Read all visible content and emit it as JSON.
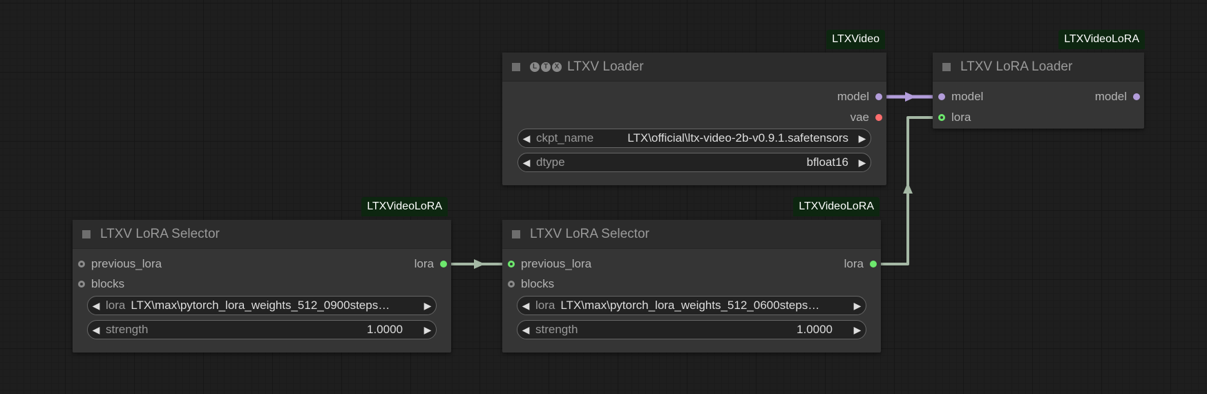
{
  "colors": {
    "model_wire": "#b39ddb",
    "lora_wire": "#a5b8a5",
    "badge_bg": "#0d2610",
    "model_slot": "#b39ddb",
    "vae_slot": "#ff6e6e",
    "lora_slot": "#6de86d"
  },
  "loader": {
    "badge": "LTXVideo",
    "title": "LTXV Loader",
    "logo_letters": [
      "L",
      "T",
      "X"
    ],
    "outputs": {
      "model": "model",
      "vae": "vae"
    },
    "widgets": {
      "ckpt_name": {
        "name": "ckpt_name",
        "value": "LTX\\official\\ltx-video-2b-v0.9.1.safetensors"
      },
      "dtype": {
        "name": "dtype",
        "value": "bfloat16"
      }
    }
  },
  "lora_loader": {
    "badge": "LTXVideoLoRA",
    "title": "LTXV LoRA Loader",
    "inputs": {
      "model": "model",
      "lora": "lora"
    },
    "outputs": {
      "model": "model"
    }
  },
  "selector_left": {
    "badge": "LTXVideoLoRA",
    "title": "LTXV LoRA Selector",
    "inputs": {
      "previous_lora": "previous_lora",
      "blocks": "blocks"
    },
    "outputs": {
      "lora": "lora"
    },
    "widgets": {
      "lora": {
        "name": "lora",
        "value": "LTX\\max\\pytorch_lora_weights_512_0900steps…"
      },
      "strength": {
        "name": "strength",
        "value": "1.0000"
      }
    }
  },
  "selector_mid": {
    "badge": "LTXVideoLoRA",
    "title": "LTXV LoRA Selector",
    "inputs": {
      "previous_lora": "previous_lora",
      "blocks": "blocks"
    },
    "outputs": {
      "lora": "lora"
    },
    "widgets": {
      "lora": {
        "name": "lora",
        "value": "LTX\\max\\pytorch_lora_weights_512_0600steps…"
      },
      "strength": {
        "name": "strength",
        "value": "1.0000"
      }
    }
  }
}
